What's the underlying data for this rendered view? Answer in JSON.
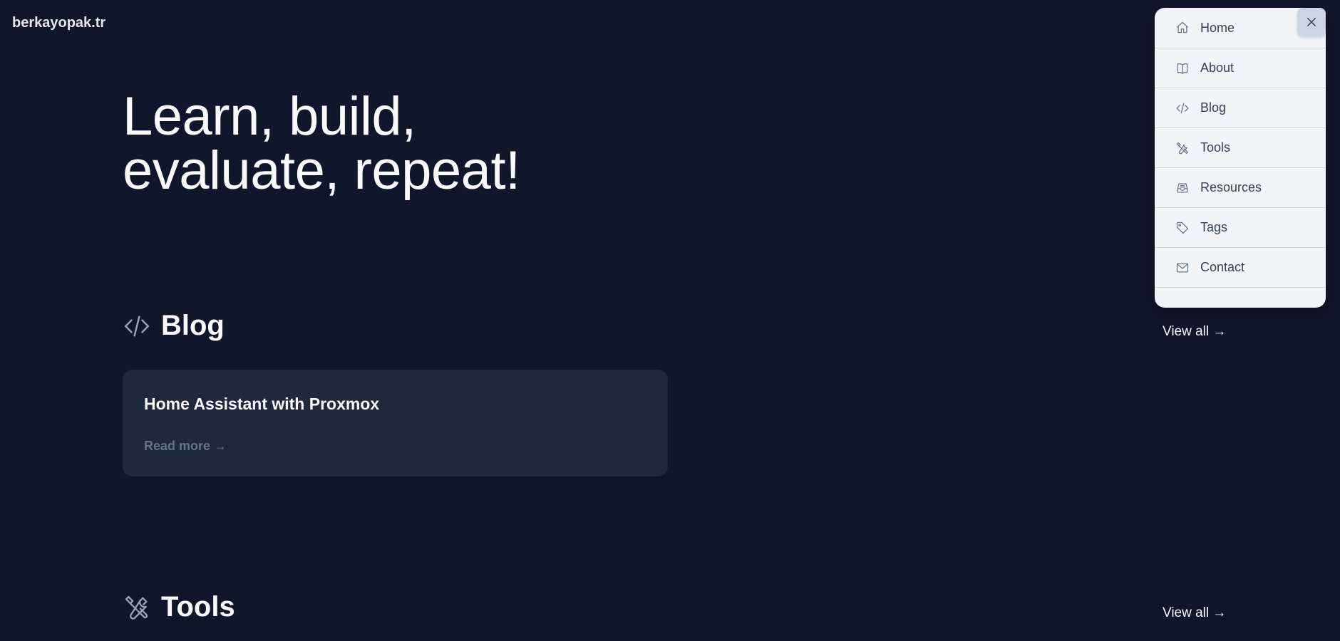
{
  "site": {
    "logo": "berkayopak.tr"
  },
  "hero": {
    "line1": "Learn, build,",
    "line2": "evaluate, repeat!"
  },
  "blog": {
    "title": "Blog",
    "view_all": "View all →",
    "posts": [
      {
        "title": "Home Assistant with Proxmox",
        "read_more": "Read more →"
      }
    ]
  },
  "tools": {
    "title": "Tools",
    "view_all": "View all →"
  },
  "menu": {
    "items": [
      {
        "label": "Home",
        "icon": "home-icon"
      },
      {
        "label": "About",
        "icon": "book-icon"
      },
      {
        "label": "Blog",
        "icon": "code-icon"
      },
      {
        "label": "Tools",
        "icon": "tools-icon"
      },
      {
        "label": "Resources",
        "icon": "inbox-icon"
      },
      {
        "label": "Tags",
        "icon": "tag-icon"
      },
      {
        "label": "Contact",
        "icon": "mail-icon"
      }
    ]
  },
  "colors": {
    "background": "#0f172a",
    "card": "#1e293b",
    "menu_bg": "#f1f5f9",
    "muted": "#64748b"
  }
}
